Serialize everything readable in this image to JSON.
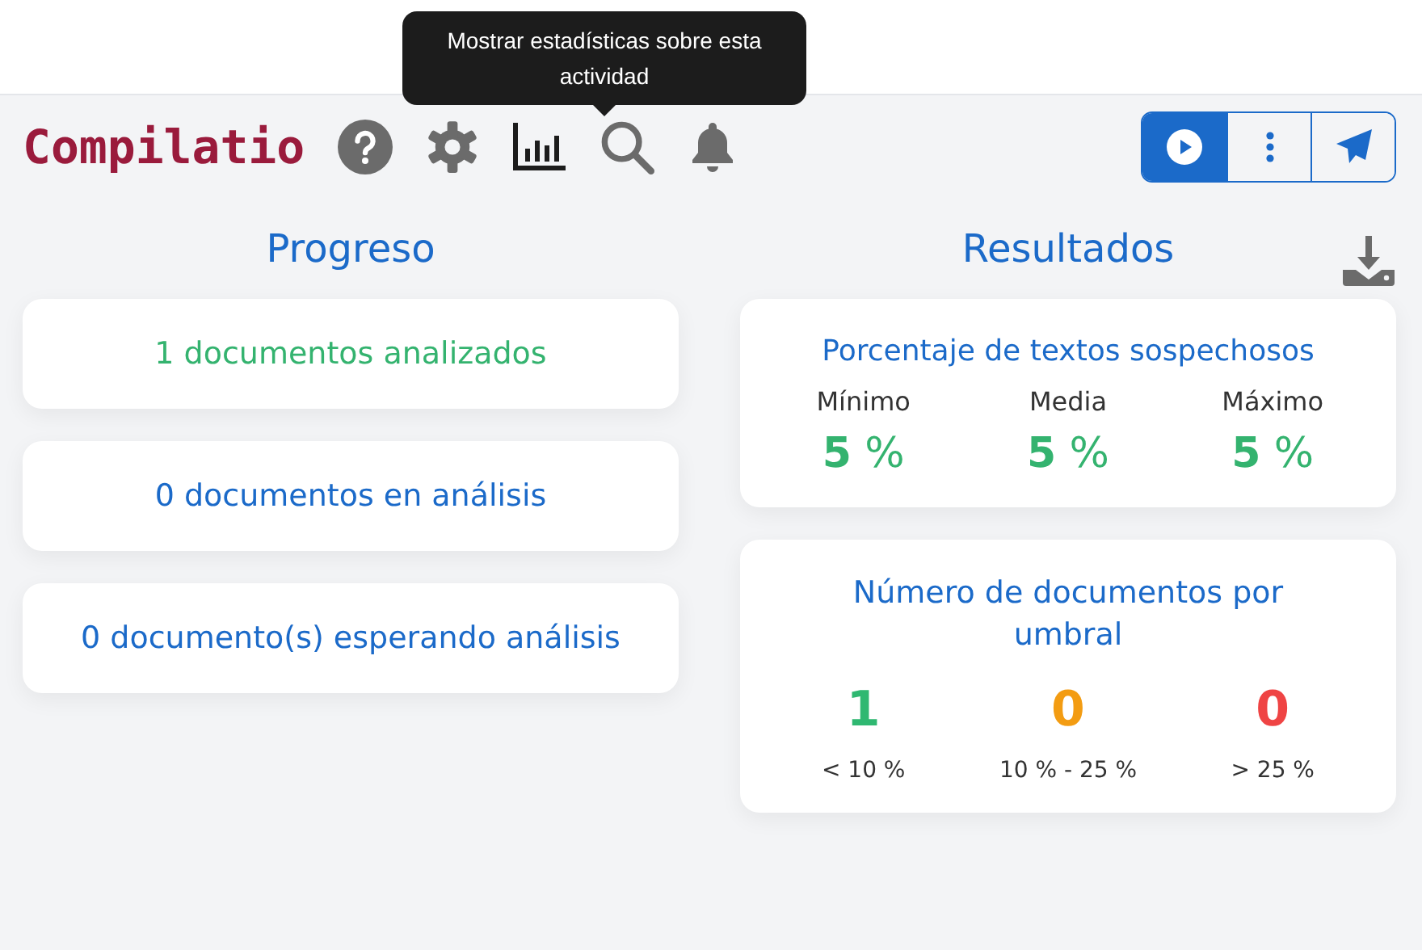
{
  "tooltip": {
    "text": "Mostrar estadísticas sobre esta actividad"
  },
  "logo": {
    "text": "Compilatio"
  },
  "progress": {
    "title": "Progreso",
    "items": [
      {
        "text": "1 documentos analizados",
        "kind": "done"
      },
      {
        "text": "0 documentos en análisis",
        "kind": "pending"
      },
      {
        "text": "0 documento(s) esperando análisis",
        "kind": "pending"
      }
    ]
  },
  "results": {
    "title": "Resultados",
    "suspicious": {
      "title": "Porcentaje de textos sospechosos",
      "stats": [
        {
          "label": "Mínimo",
          "value": "5",
          "unit": "%"
        },
        {
          "label": "Media",
          "value": "5",
          "unit": "%"
        },
        {
          "label": "Máximo",
          "value": "5",
          "unit": "%"
        }
      ]
    },
    "thresholds": {
      "title": "Número de documentos por umbral",
      "items": [
        {
          "count": "1",
          "label": "< 10 %",
          "color": "#2fb871"
        },
        {
          "count": "0",
          "label": "10 % - 25 %",
          "color": "#f39c12"
        },
        {
          "count": "0",
          "label": "> 25 %",
          "color": "#ef4444"
        }
      ]
    }
  }
}
